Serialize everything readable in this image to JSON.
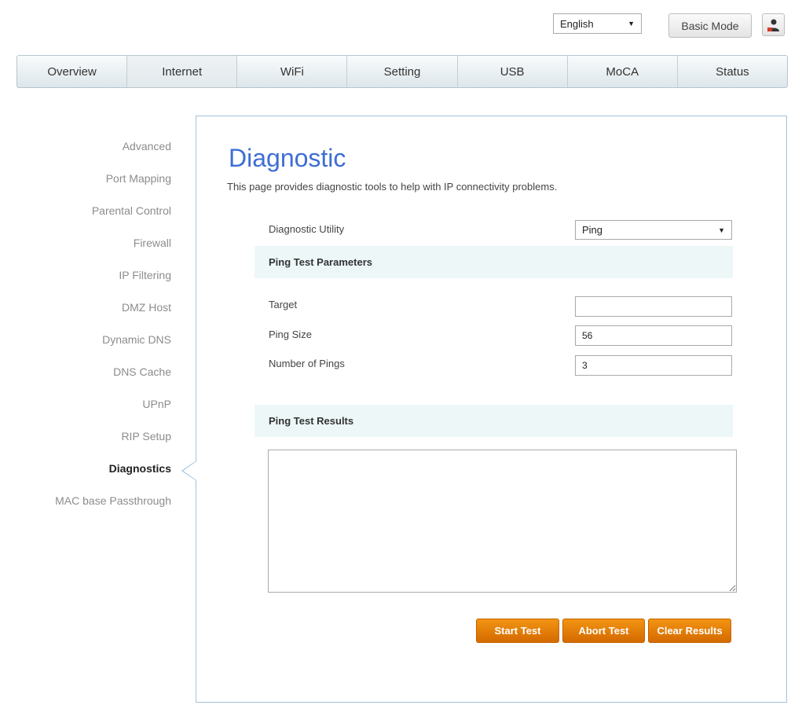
{
  "header": {
    "language": "English",
    "language_arrow": "▼",
    "mode_button": "Basic Mode",
    "user_icon": "user-icon"
  },
  "nav": {
    "tabs": [
      {
        "label": "Overview"
      },
      {
        "label": "Internet",
        "active": true
      },
      {
        "label": "WiFi"
      },
      {
        "label": "Setting"
      },
      {
        "label": "USB"
      },
      {
        "label": "MoCA"
      },
      {
        "label": "Status"
      }
    ]
  },
  "sidebar": {
    "items": [
      {
        "label": "Advanced"
      },
      {
        "label": "Port Mapping"
      },
      {
        "label": "Parental Control"
      },
      {
        "label": "Firewall"
      },
      {
        "label": "IP Filtering"
      },
      {
        "label": "DMZ Host"
      },
      {
        "label": "Dynamic DNS"
      },
      {
        "label": "DNS Cache"
      },
      {
        "label": "UPnP"
      },
      {
        "label": "RIP Setup"
      },
      {
        "label": "Diagnostics",
        "active": true
      },
      {
        "label": "MAC base Passthrough"
      }
    ]
  },
  "main": {
    "title": "Diagnostic",
    "description": "This page provides diagnostic tools to help with IP connectivity problems.",
    "utility_label": "Diagnostic Utility",
    "utility_value": "Ping",
    "utility_arrow": "▼",
    "params_header": "Ping Test Parameters",
    "target_label": "Target",
    "target_value": "",
    "ping_size_label": "Ping Size",
    "ping_size_value": "56",
    "num_pings_label": "Number of Pings",
    "num_pings_value": "3",
    "results_header": "Ping Test Results",
    "results_value": ""
  },
  "buttons": {
    "start": "Start Test",
    "abort": "Abort Test",
    "clear": "Clear Results"
  },
  "colors": {
    "title_blue": "#3d6ed4",
    "button_orange": "#e07d08",
    "section_bg": "#edf7f8",
    "panel_border": "#9fc3dc"
  }
}
